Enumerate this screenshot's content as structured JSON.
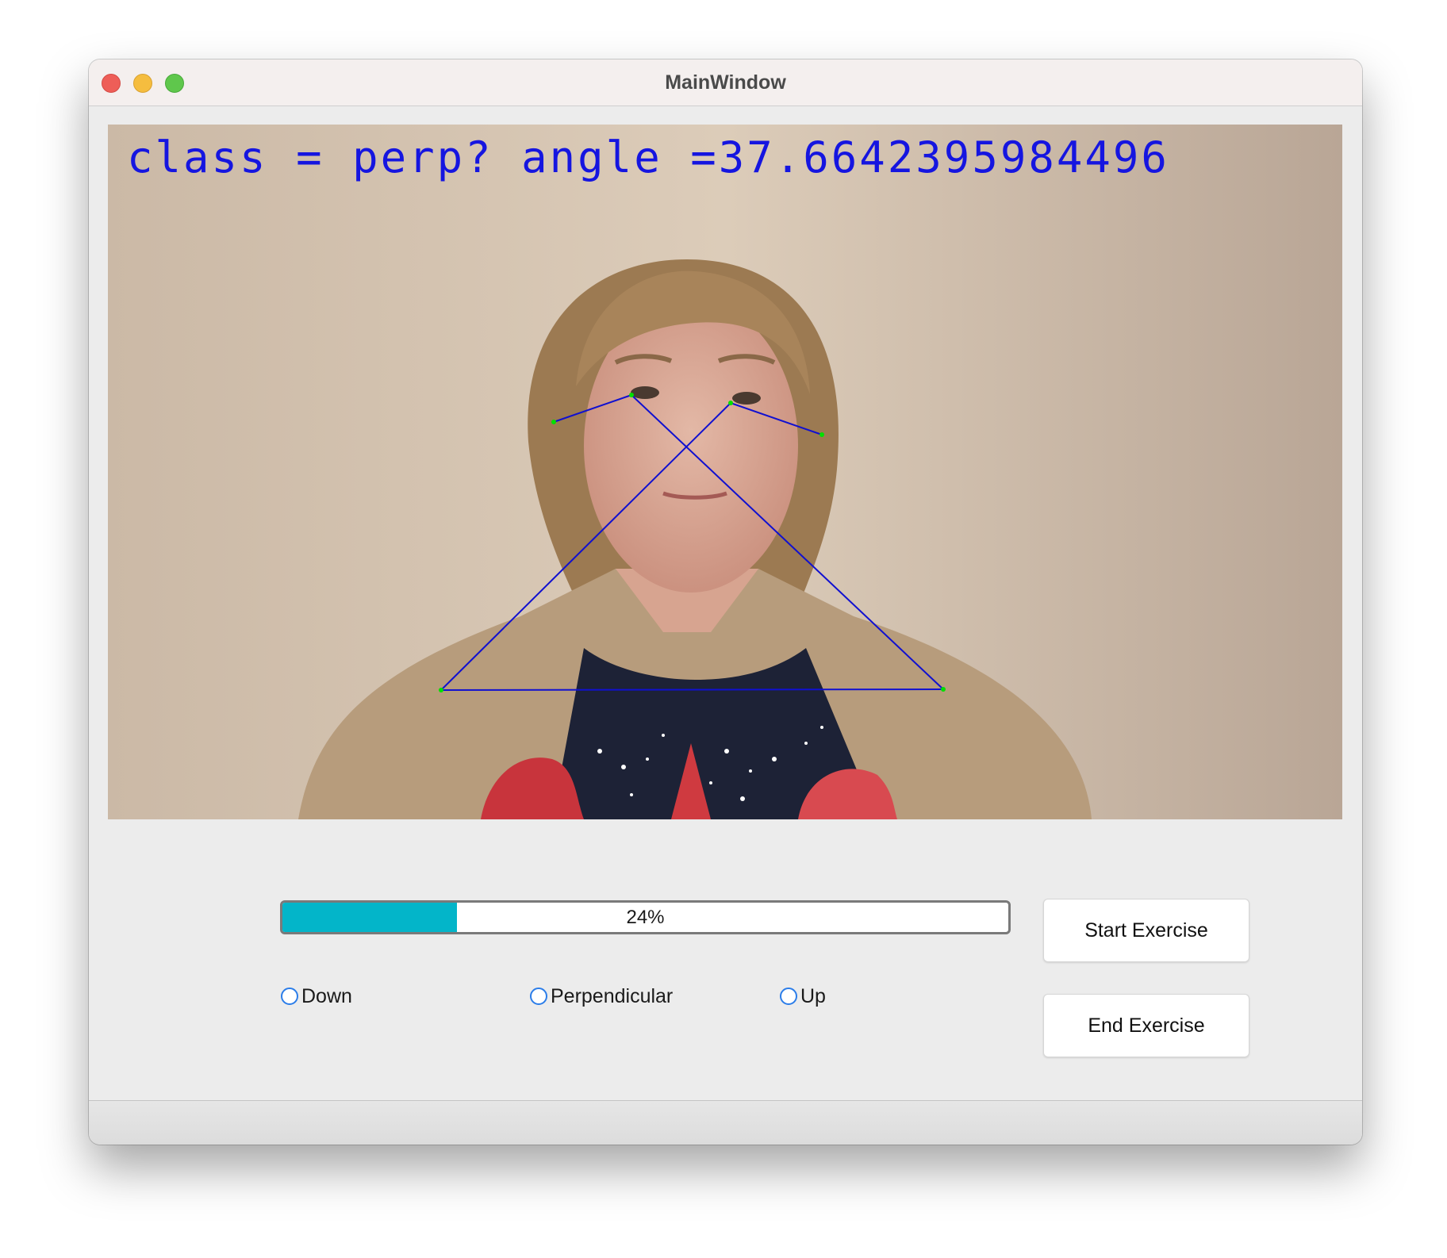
{
  "window": {
    "title": "MainWindow"
  },
  "camera": {
    "overlay_text": "class = perp? angle =37.6642395984496"
  },
  "progress": {
    "value_percent": 24,
    "label": "24%",
    "fill_color": "#03b5c9"
  },
  "radios": [
    {
      "label": "Down",
      "checked": false
    },
    {
      "label": "Perpendicular",
      "checked": false
    },
    {
      "label": "Up",
      "checked": false
    }
  ],
  "buttons": {
    "start_label": "Start Exercise",
    "end_label": "End Exercise"
  },
  "colors": {
    "overlay_text": "#1515e0",
    "pose_lines": "#1010d0",
    "keypoints": "#00e000",
    "radio_accent": "#2b7de9"
  }
}
